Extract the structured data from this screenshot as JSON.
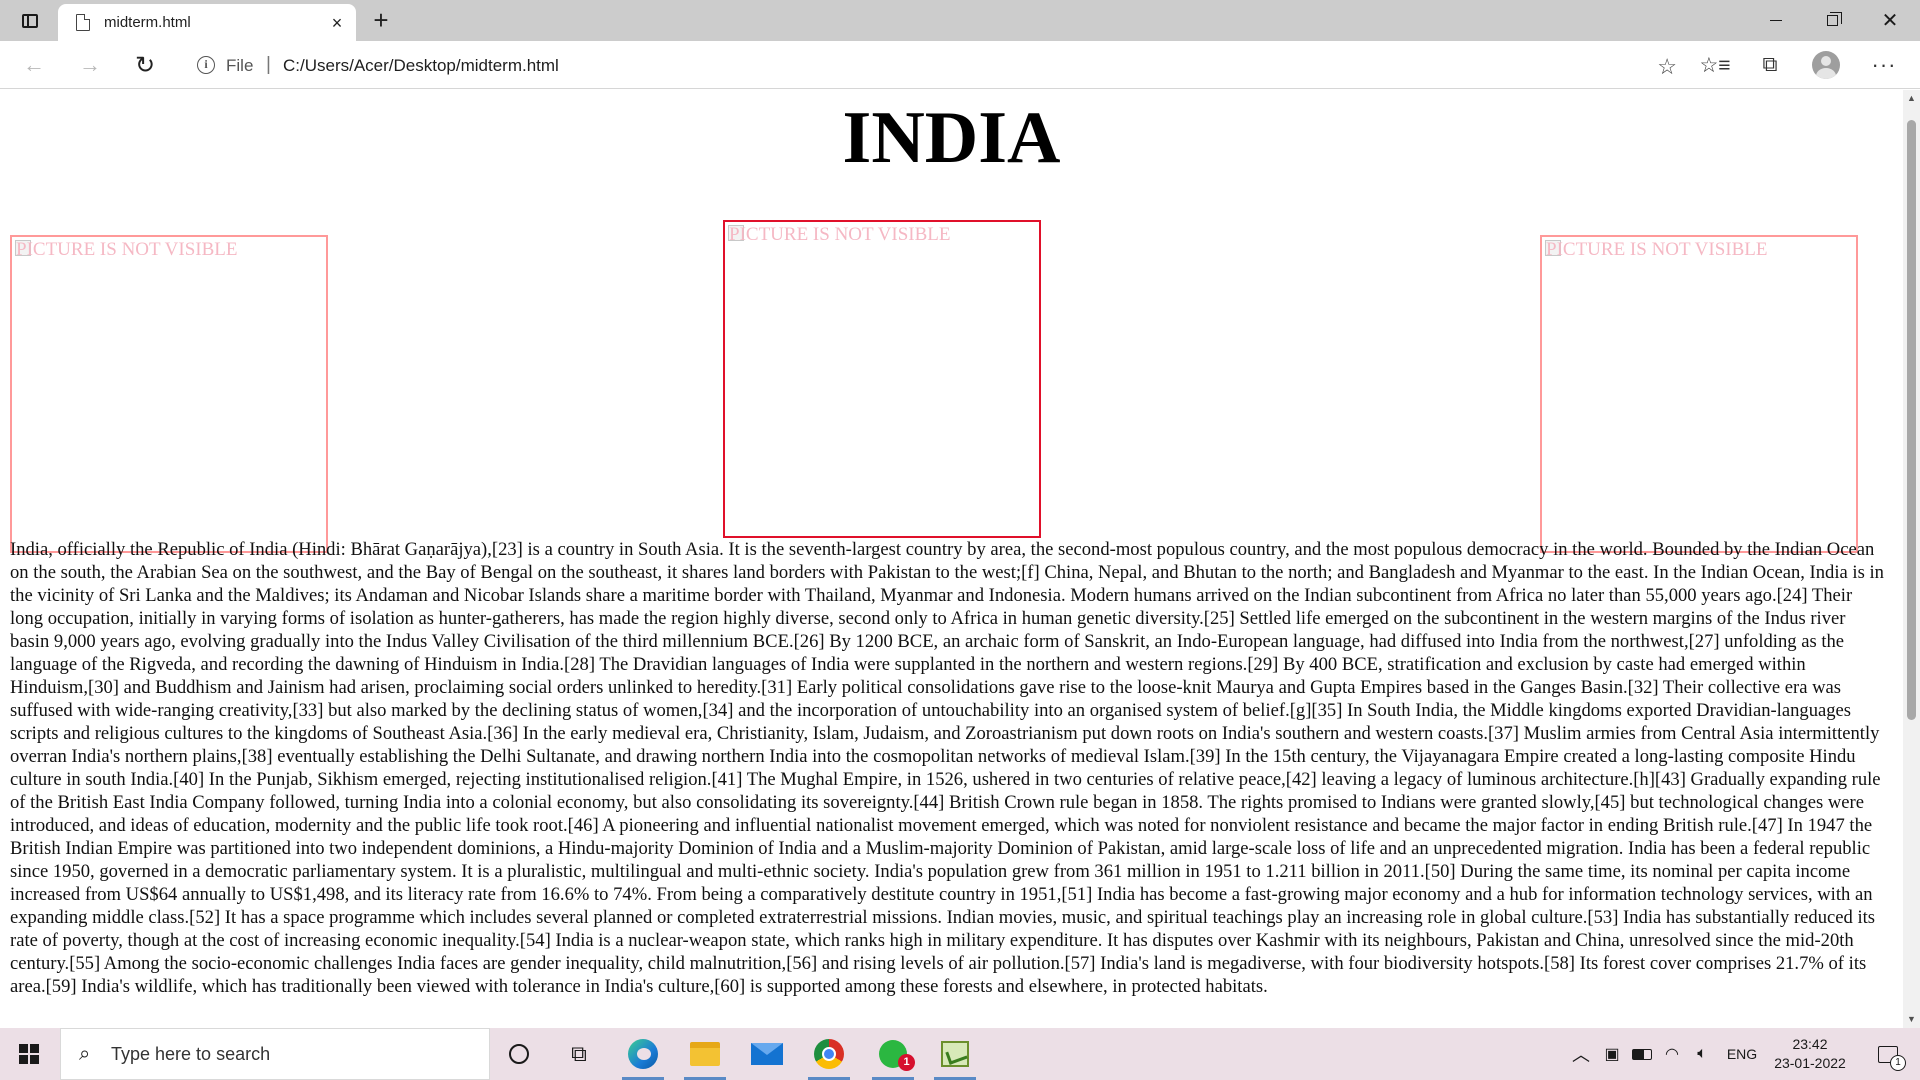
{
  "browser": {
    "tab_title": "midterm.html",
    "tab_close_glyph": "×",
    "new_tab_glyph": "+",
    "address": {
      "scheme_label": "File",
      "separator": "|",
      "url": "C:/Users/Acer/Desktop/midterm.html"
    },
    "icons": {
      "sidebar": "sidebar-toggle-icon",
      "back": "arrow-left-icon",
      "forward": "arrow-right-icon",
      "reload": "reload-icon",
      "info": "info-icon",
      "add_favorite": "star-plus-icon",
      "favorites": "favorites-list-icon",
      "collections": "collections-icon",
      "profile": "profile-avatar-icon",
      "more": "more-dots-icon"
    }
  },
  "page": {
    "heading": "INDIA",
    "images": [
      {
        "alt": "PICTURE IS NOT VISIBLE"
      },
      {
        "alt": "PICTURE IS NOT VISIBLE"
      },
      {
        "alt": "PICTURE IS NOT VISIBLE"
      }
    ],
    "paragraph": "India, officially the Republic of India (Hindi: Bhārat Gaṇarājya),[23] is a country in South Asia. It is the seventh-largest country by area, the second-most populous country, and the most populous democracy in the world. Bounded by the Indian Ocean on the south, the Arabian Sea on the southwest, and the Bay of Bengal on the southeast, it shares land borders with Pakistan to the west;[f] China, Nepal, and Bhutan to the north; and Bangladesh and Myanmar to the east. In the Indian Ocean, India is in the vicinity of Sri Lanka and the Maldives; its Andaman and Nicobar Islands share a maritime border with Thailand, Myanmar and Indonesia. Modern humans arrived on the Indian subcontinent from Africa no later than 55,000 years ago.[24] Their long occupation, initially in varying forms of isolation as hunter-gatherers, has made the region highly diverse, second only to Africa in human genetic diversity.[25] Settled life emerged on the subcontinent in the western margins of the Indus river basin 9,000 years ago, evolving gradually into the Indus Valley Civilisation of the third millennium BCE.[26] By 1200 BCE, an archaic form of Sanskrit, an Indo-European language, had diffused into India from the northwest,[27] unfolding as the language of the Rigveda, and recording the dawning of Hinduism in India.[28] The Dravidian languages of India were supplanted in the northern and western regions.[29] By 400 BCE, stratification and exclusion by caste had emerged within Hinduism,[30] and Buddhism and Jainism had arisen, proclaiming social orders unlinked to heredity.[31] Early political consolidations gave rise to the loose-knit Maurya and Gupta Empires based in the Ganges Basin.[32] Their collective era was suffused with wide-ranging creativity,[33] but also marked by the declining status of women,[34] and the incorporation of untouchability into an organised system of belief.[g][35] In South India, the Middle kingdoms exported Dravidian-languages scripts and religious cultures to the kingdoms of Southeast Asia.[36] In the early medieval era, Christianity, Islam, Judaism, and Zoroastrianism put down roots on India's southern and western coasts.[37] Muslim armies from Central Asia intermittently overran India's northern plains,[38] eventually establishing the Delhi Sultanate, and drawing northern India into the cosmopolitan networks of medieval Islam.[39] In the 15th century, the Vijayanagara Empire created a long-lasting composite Hindu culture in south India.[40] In the Punjab, Sikhism emerged, rejecting institutionalised religion.[41] The Mughal Empire, in 1526, ushered in two centuries of relative peace,[42] leaving a legacy of luminous architecture.[h][43] Gradually expanding rule of the British East India Company followed, turning India into a colonial economy, but also consolidating its sovereignty.[44] British Crown rule began in 1858. The rights promised to Indians were granted slowly,[45] but technological changes were introduced, and ideas of education, modernity and the public life took root.[46] A pioneering and influential nationalist movement emerged, which was noted for nonviolent resistance and became the major factor in ending British rule.[47] In 1947 the British Indian Empire was partitioned into two independent dominions, a Hindu-majority Dominion of India and a Muslim-majority Dominion of Pakistan, amid large-scale loss of life and an unprecedented migration. India has been a federal republic since 1950, governed in a democratic parliamentary system. It is a pluralistic, multilingual and multi-ethnic society. India's population grew from 361 million in 1951 to 1.211 billion in 2011.[50] During the same time, its nominal per capita income increased from US$64 annually to US$1,498, and its literacy rate from 16.6% to 74%. From being a comparatively destitute country in 1951,[51] India has become a fast-growing major economy and a hub for information technology services, with an expanding middle class.[52] It has a space programme which includes several planned or completed extraterrestrial missions. Indian movies, music, and spiritual teachings play an increasing role in global culture.[53] India has substantially reduced its rate of poverty, though at the cost of increasing economic inequality.[54] India is a nuclear-weapon state, which ranks high in military expenditure. It has disputes over Kashmir with its neighbours, Pakistan and China, unresolved since the mid-20th century.[55] Among the socio-economic challenges India faces are gender inequality, child malnutrition,[56] and rising levels of air pollution.[57] India's land is megadiverse, with four biodiversity hotspots.[58] Its forest cover comprises 21.7% of its area.[59] India's wildlife, which has traditionally been viewed with tolerance in India's culture,[60] is supported among these forests and elsewhere, in protected habitats."
  },
  "taskbar": {
    "search_placeholder": "Type here to search",
    "whatsapp_badge": "1",
    "language": "ENG",
    "time": "23:42",
    "date": "23-01-2022",
    "notification_count": "1",
    "apps": [
      "edge-icon",
      "file-explorer-icon",
      "mail-icon",
      "chrome-icon",
      "whatsapp-icon",
      "app-icon"
    ]
  }
}
